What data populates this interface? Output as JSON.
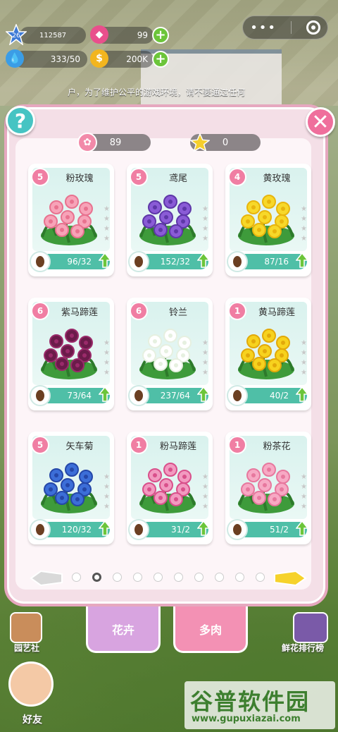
{
  "hud": {
    "level": "26",
    "exp": "112587",
    "gems": "99",
    "water": "333/50",
    "gold": "200K"
  },
  "notice": "户，为了维护公平的游戏环境，请不要通过任何",
  "panel": {
    "counter_flowers": "89",
    "counter_stars": "0"
  },
  "cards": [
    {
      "level": "5",
      "name": "粉玫瑰",
      "count": "96/32"
    },
    {
      "level": "5",
      "name": "鸢尾",
      "count": "152/32"
    },
    {
      "level": "4",
      "name": "黄玫瑰",
      "count": "87/16"
    },
    {
      "level": "6",
      "name": "紫马蹄莲",
      "count": "73/64"
    },
    {
      "level": "6",
      "name": "铃兰",
      "count": "237/64"
    },
    {
      "level": "1",
      "name": "黄马蹄莲",
      "count": "40/2"
    },
    {
      "level": "5",
      "name": "矢车菊",
      "count": "120/32"
    },
    {
      "level": "1",
      "name": "粉马蹄莲",
      "count": "31/2"
    },
    {
      "level": "1",
      "name": "粉茶花",
      "count": "51/2"
    }
  ],
  "tabs": {
    "flowers": "花卉",
    "succulents": "多肉"
  },
  "bottom": {
    "garden_club": "园艺社",
    "ranking": "鲜花排行榜",
    "friends": "好友"
  },
  "watermark": {
    "title": "谷普软件园",
    "url": "www.gupuxiazai.com"
  },
  "colors": {
    "accent_pink": "#f07ea3",
    "card_bar": "#4fbfa7",
    "panel_bg": "#f4dfe7"
  }
}
